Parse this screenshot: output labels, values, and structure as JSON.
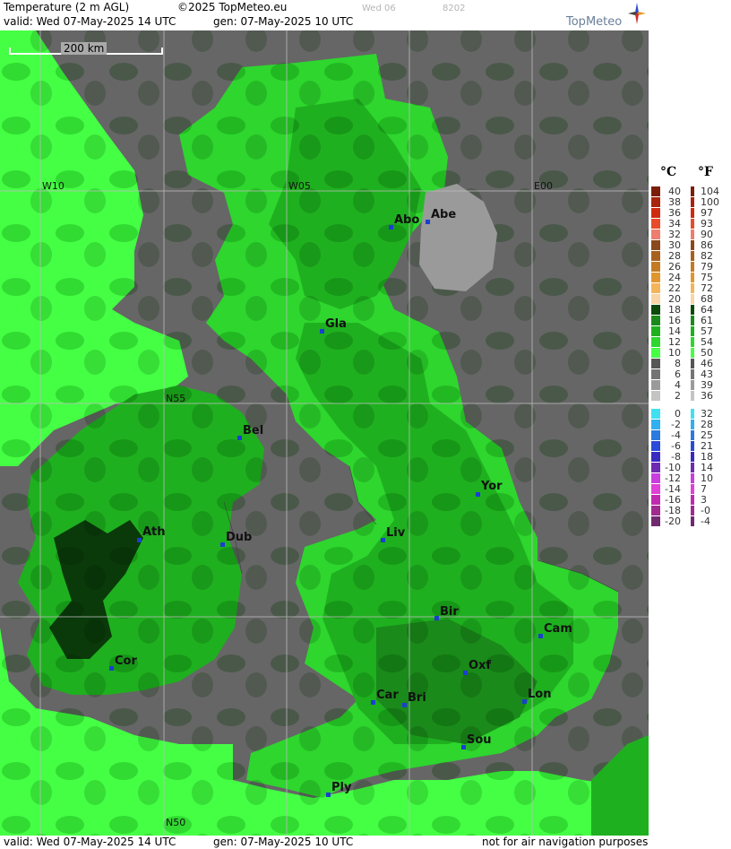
{
  "header": {
    "product": "Temperature (2 m AGL)",
    "copyright": "©2025 TopMeteo.eu",
    "faint_day": "Wed 06",
    "faint_code": "8202",
    "valid": "valid:  Wed  07-May-2025  14 UTC",
    "gen": "gen: 07-May-2025 10 UTC",
    "logo_text": "TopMeteo"
  },
  "footer": {
    "valid": "valid:  Wed  07-May-2025  14 UTC",
    "gen": "gen: 07-May-2025 10 UTC",
    "disclaimer": "not for air navigation purposes"
  },
  "map": {
    "scale_label": "200 km",
    "grid_labels": {
      "w10": "W10",
      "w05": "W05",
      "e00": "E00",
      "n55": "N55",
      "n50": "N50"
    },
    "cities": [
      {
        "name": "Abo"
      },
      {
        "name": "Abe"
      },
      {
        "name": "Gla"
      },
      {
        "name": "Bel"
      },
      {
        "name": "Yor"
      },
      {
        "name": "Ath"
      },
      {
        "name": "Dub"
      },
      {
        "name": "Liv"
      },
      {
        "name": "Bir"
      },
      {
        "name": "Cam"
      },
      {
        "name": "Cor"
      },
      {
        "name": "Oxf"
      },
      {
        "name": "Car"
      },
      {
        "name": "Bri"
      },
      {
        "name": "Lon"
      },
      {
        "name": "Sou"
      },
      {
        "name": "Ply"
      }
    ]
  },
  "legend": {
    "celsius_header": "°C",
    "fahrenheit_header": "°F",
    "celsius": [
      "40",
      "38",
      "36",
      "34",
      "32",
      "30",
      "28",
      "26",
      "24",
      "22",
      "20",
      "18",
      "16",
      "14",
      "12",
      "10",
      "8",
      "6",
      "4",
      "2",
      "0",
      "-2",
      "-4",
      "-6",
      "-8",
      "-10",
      "-12",
      "-14",
      "-16",
      "-18",
      "-20"
    ],
    "fahrenheit": [
      "104",
      "100",
      "97",
      "93",
      "90",
      "86",
      "82",
      "79",
      "75",
      "72",
      "68",
      "64",
      "61",
      "57",
      "54",
      "50",
      "46",
      "43",
      "39",
      "36",
      "32",
      "28",
      "25",
      "21",
      "18",
      "14",
      "10",
      "7",
      "3",
      "-0",
      "-4"
    ],
    "colors": [
      "#7a1e0a",
      "#a8240c",
      "#cf2a10",
      "#e84a2a",
      "#ee7d6e",
      "#8b4a1e",
      "#a8601e",
      "#c47a22",
      "#e0962e",
      "#f5b45a",
      "#f8d4a6",
      "#0c4a0c",
      "#1a8a1a",
      "#1fb01f",
      "#2ed62e",
      "#44ff44",
      "#555555",
      "#747474",
      "#9a9a9a",
      "#c4c4c4",
      "#40e0f0",
      "#30b0f0",
      "#2a7ae0",
      "#2a4ad8",
      "#3a2ac0",
      "#6e2ab0",
      "#c83ce0",
      "#e040d8",
      "#c02ab0",
      "#a02a90",
      "#702a70"
    ]
  }
}
